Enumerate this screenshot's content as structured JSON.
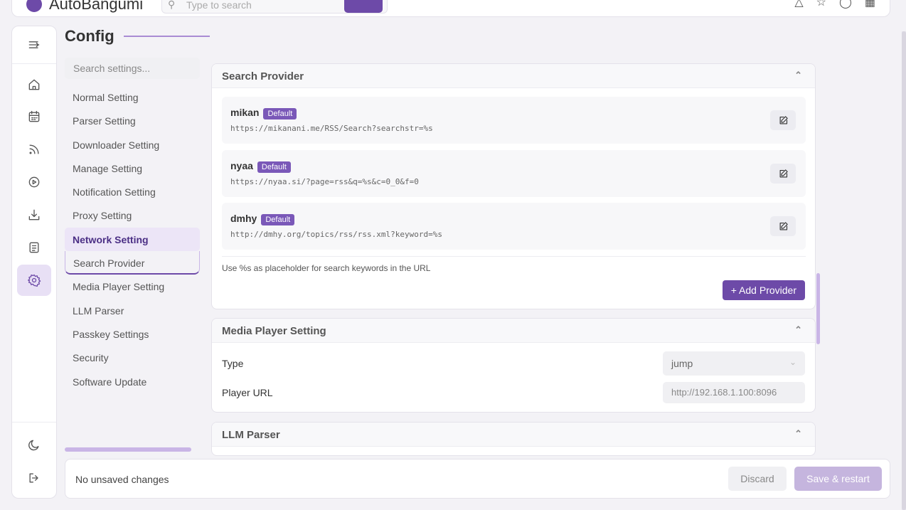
{
  "header": {
    "app_name": "AutoBangumi",
    "search_placeholder": "Type to search"
  },
  "page_title": "Config",
  "settings_nav": {
    "search_placeholder": "Search settings...",
    "items": [
      {
        "label": "Normal Setting"
      },
      {
        "label": "Parser Setting"
      },
      {
        "label": "Downloader Setting"
      },
      {
        "label": "Manage Setting"
      },
      {
        "label": "Notification Setting"
      },
      {
        "label": "Proxy Setting"
      },
      {
        "label": "Network Setting",
        "state": "active"
      },
      {
        "label": "Search Provider",
        "state": "hover"
      },
      {
        "label": "Media Player Setting"
      },
      {
        "label": "LLM Parser"
      },
      {
        "label": "Passkey Settings"
      },
      {
        "label": "Security"
      },
      {
        "label": "Software Update"
      }
    ]
  },
  "search_provider": {
    "title": "Search Provider",
    "providers": [
      {
        "name": "mikan",
        "badge": "Default",
        "url": "https://mikanani.me/RSS/Search?searchstr=%s"
      },
      {
        "name": "nyaa",
        "badge": "Default",
        "url": "https://nyaa.si/?page=rss&q=%s&c=0_0&f=0"
      },
      {
        "name": "dmhy",
        "badge": "Default",
        "url": "http://dmhy.org/topics/rss/rss.xml?keyword=%s"
      }
    ],
    "hint": "Use %s as placeholder for search keywords in the URL",
    "add_label": "+  Add Provider"
  },
  "media_player": {
    "title": "Media Player Setting",
    "type_label": "Type",
    "type_value": "jump",
    "url_label": "Player URL",
    "url_placeholder": "http://192.168.1.100:8096"
  },
  "llm_parser": {
    "title": "LLM Parser"
  },
  "footer": {
    "status": "No unsaved changes",
    "discard_label": "Discard",
    "save_label": "Save & restart"
  },
  "colors": {
    "accent": "#6d4aa8",
    "accent_light": "#ece5f7",
    "save_disabled": "#c5b5de"
  }
}
